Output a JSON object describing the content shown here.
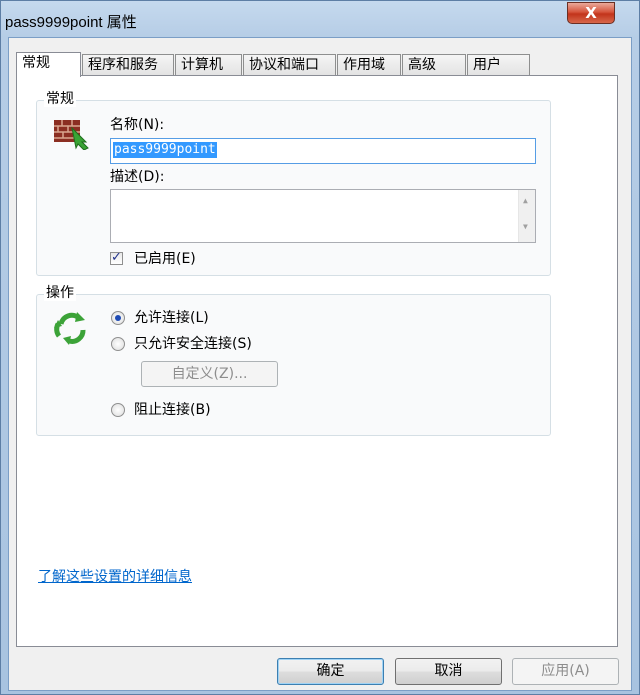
{
  "window": {
    "title": "pass9999point 属性",
    "close_label": "X"
  },
  "tabs": [
    "常规",
    "程序和服务",
    "计算机",
    "协议和端口",
    "作用域",
    "高级",
    "用户"
  ],
  "general_group": {
    "label": "常规",
    "name_label": "名称(N):",
    "name_value": "pass9999point",
    "description_label": "描述(D):",
    "description_value": "",
    "enabled_label": "已启用(E)",
    "enabled_checked": true
  },
  "action_group": {
    "label": "操作",
    "options": [
      {
        "label": "允许连接(L)",
        "selected": true
      },
      {
        "label": "只允许安全连接(S)",
        "selected": false
      },
      {
        "label": "阻止连接(B)",
        "selected": false
      }
    ],
    "customize_button": "自定义(Z)..."
  },
  "info_link": "了解这些设置的详细信息",
  "buttons": {
    "ok": "确定",
    "cancel": "取消",
    "apply": "应用(A)"
  },
  "icons": {
    "firewall": "brick-wall-with-green-arrow-icon",
    "action": "green-recycle-arrows-icon"
  },
  "colors": {
    "link": "#0066cc",
    "selection": "#3399ff",
    "close": "#c2341b"
  }
}
